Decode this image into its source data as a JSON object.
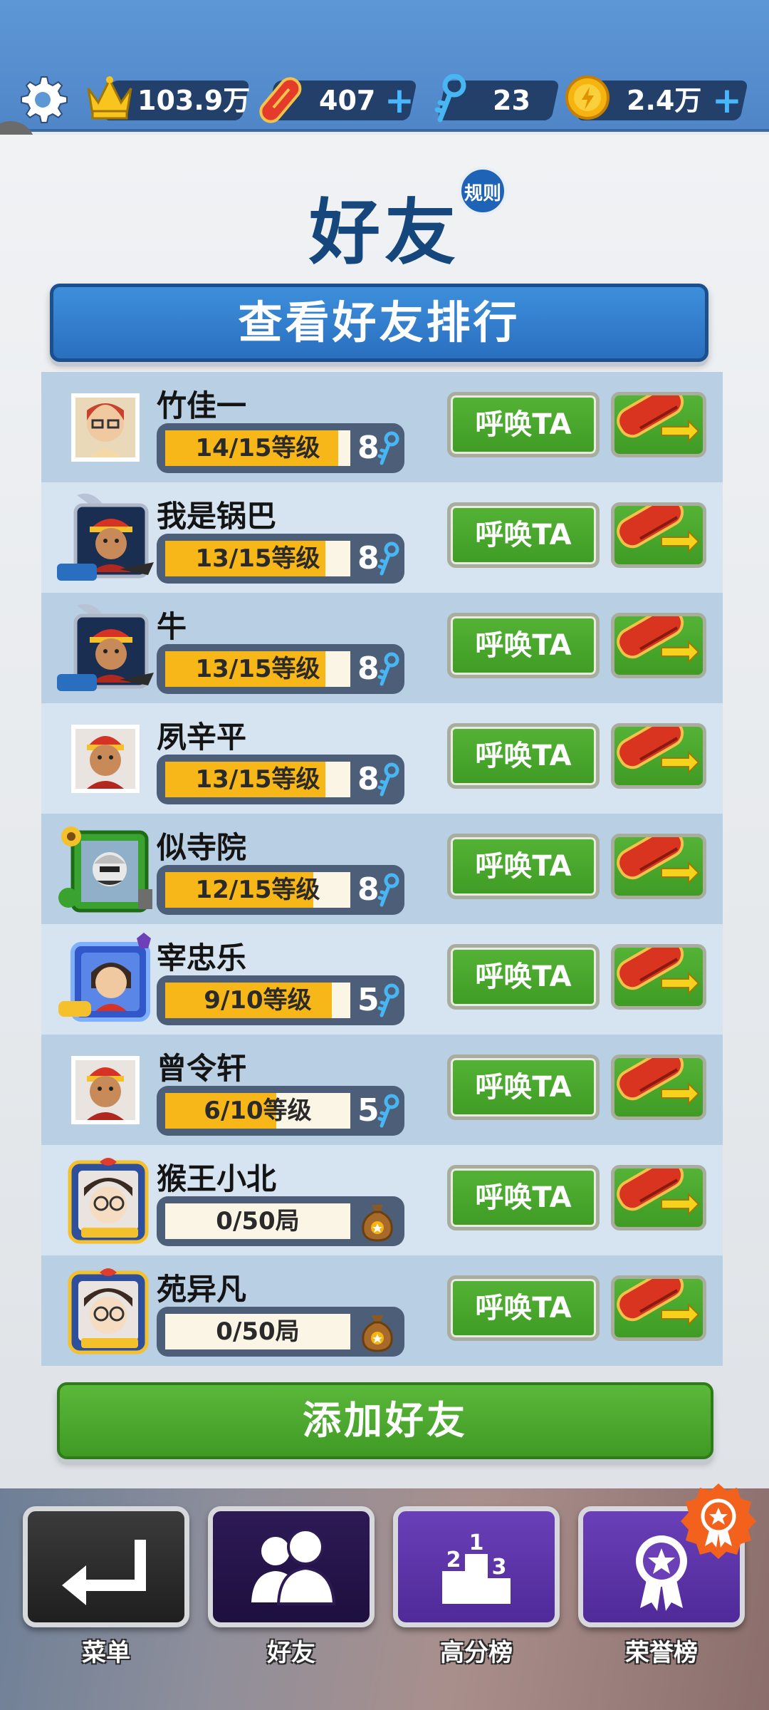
{
  "currency": {
    "trophies": "103.9万",
    "boards": "407",
    "keys": "23",
    "coins": "2.4万",
    "plus_label": "+"
  },
  "header": {
    "title": "好友",
    "rules_label": "规则",
    "rank_button_label": "查看好友排行"
  },
  "friends": [
    {
      "name": "竹佳一",
      "progress_text": "14/15等级",
      "progress": 0.933,
      "keys": "8",
      "reward": "key",
      "avatar": "glasses-girl"
    },
    {
      "name": "我是锅巴",
      "progress_text": "13/15等级",
      "progress": 0.867,
      "keys": "8",
      "reward": "key",
      "avatar": "jake-legend"
    },
    {
      "name": "牛",
      "progress_text": "13/15等级",
      "progress": 0.867,
      "keys": "8",
      "reward": "key",
      "avatar": "jake-legend"
    },
    {
      "name": "夙辛平",
      "progress_text": "13/15等级",
      "progress": 0.867,
      "keys": "8",
      "reward": "key",
      "avatar": "jake"
    },
    {
      "name": "似寺院",
      "progress_text": "12/15等级",
      "progress": 0.8,
      "keys": "8",
      "reward": "key",
      "avatar": "zombie-frame"
    },
    {
      "name": "宰忠乐",
      "progress_text": "9/10等级",
      "progress": 0.9,
      "keys": "5",
      "reward": "key",
      "avatar": "girl-frame"
    },
    {
      "name": "曾令轩",
      "progress_text": "6/10等级",
      "progress": 0.6,
      "keys": "5",
      "reward": "key",
      "avatar": "jake"
    },
    {
      "name": "猴王小北",
      "progress_text": "0/50局",
      "progress": 0,
      "keys": "",
      "reward": "bag",
      "avatar": "detective"
    },
    {
      "name": "苑异凡",
      "progress_text": "0/50局",
      "progress": 0,
      "keys": "",
      "reward": "bag",
      "avatar": "detective"
    }
  ],
  "summon_label": "呼唤TA",
  "add_friend_label": "添加好友",
  "nav": {
    "menu": "菜单",
    "friends": "好友",
    "highscore": "高分榜",
    "honor": "荣誉榜"
  },
  "colors": {
    "title": "#15477c",
    "green_button": "#4aa82d",
    "blue_button": "#2f78c8",
    "progress_fill": "#f8b718"
  }
}
